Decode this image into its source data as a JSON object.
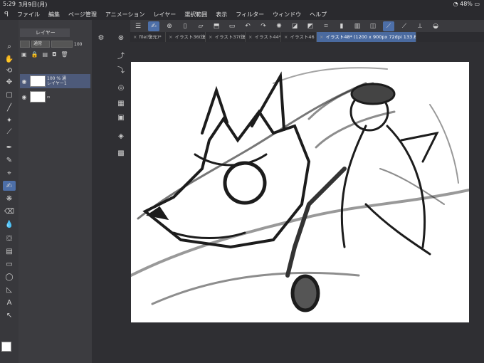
{
  "status": {
    "time": "5:29",
    "date": "3月9日(月)",
    "battery": "48%"
  },
  "menu": [
    "ファイル",
    "編集",
    "ページ管理",
    "アニメーション",
    "レイヤー",
    "選択範囲",
    "表示",
    "フィルター",
    "ウィンドウ",
    "ヘルプ"
  ],
  "layer_panel": {
    "tab_label": "レイヤー",
    "blend_mode": "通常",
    "opacity": "100",
    "layers": [
      {
        "line1": "100 % 通",
        "line2": "レイヤー1",
        "active": true
      },
      {
        "line1": "",
        "line2": "",
        "active": false
      }
    ]
  },
  "tabs": [
    {
      "label": "file(復元)*",
      "active": false
    },
    {
      "label": "イラスト36(復",
      "active": false
    },
    {
      "label": "イラスト37(復",
      "active": false
    },
    {
      "label": "イラスト44*",
      "active": false
    },
    {
      "label": "イラスト46",
      "active": false
    },
    {
      "label": "イラスト48* (1200 x 900px 72dpi 133.8%)",
      "active": true
    }
  ],
  "colors": {
    "accent": "#4d6fa8",
    "canvas": "#ffffff",
    "bg": "#2f2f33"
  }
}
